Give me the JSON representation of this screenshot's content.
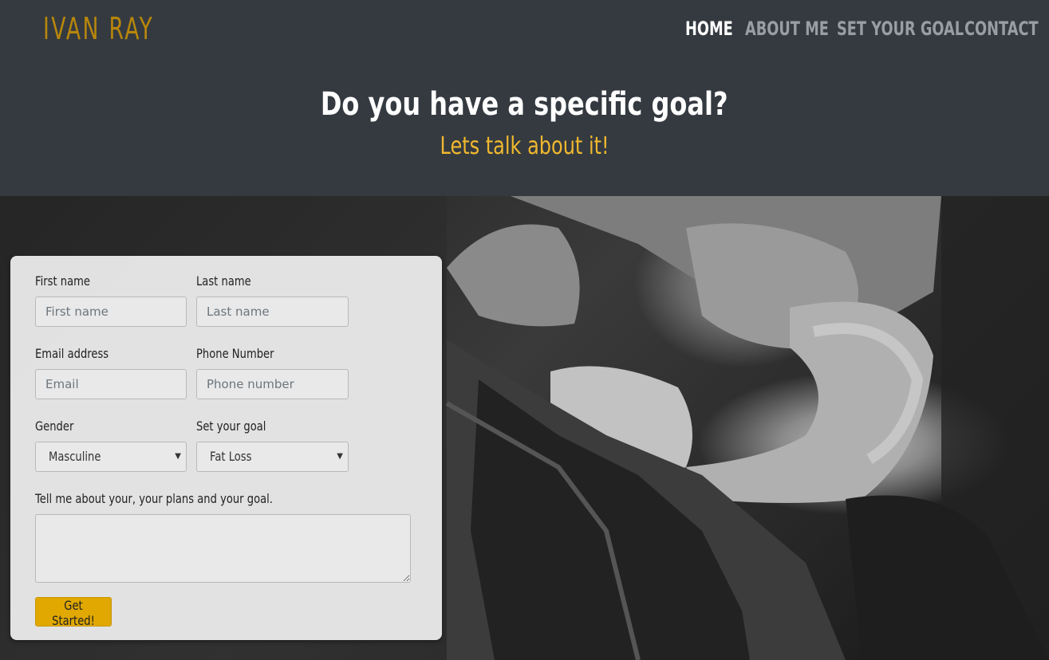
{
  "brand": "IVAN RAY",
  "nav": {
    "items": [
      {
        "label": "HOME",
        "active": true
      },
      {
        "label": "ABOUT ME",
        "active": false
      },
      {
        "label": "SET YOUR GOAL",
        "active": false
      },
      {
        "label": "CONTACT",
        "active": false
      }
    ]
  },
  "hero": {
    "title": "Do you have a specific goal?",
    "subtitle": "Lets talk about it!"
  },
  "form": {
    "first_name_label": "First name",
    "first_name_placeholder": "First name",
    "last_name_label": "Last name",
    "last_name_placeholder": "Last name",
    "email_label": "Email address",
    "email_placeholder": "Email",
    "phone_label": "Phone Number",
    "phone_placeholder": "Phone number",
    "gender_label": "Gender",
    "gender_value": "Masculine",
    "goal_label": "Set your goal",
    "goal_value": "Fat Loss",
    "message_label": "Tell me about your, your plans and your goal.",
    "message_value": "",
    "submit_label": "Get Started!"
  },
  "colors": {
    "header_bg": "#343a40",
    "brand": "#b8860b",
    "subtitle": "#f0b82e",
    "button": "#e0a800"
  }
}
